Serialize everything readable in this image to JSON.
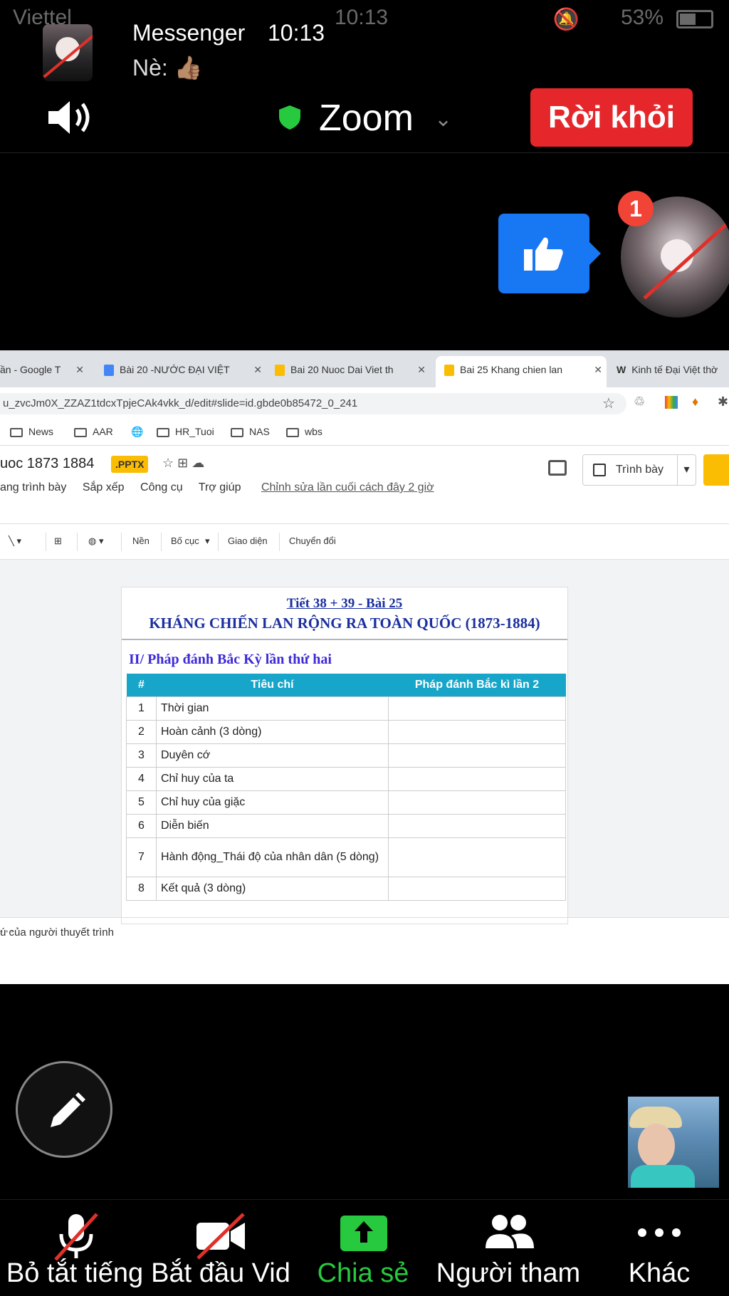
{
  "status_bar": {
    "carrier": "Viettel",
    "time": "10:13",
    "battery": "53%"
  },
  "notification": {
    "app": "Messenger",
    "time": "10:13",
    "message": "Nè: 👍🏽"
  },
  "zoom_header": {
    "title": "Zoom",
    "leave_label": "Rời khỏi"
  },
  "reaction": {
    "badge_count": "1"
  },
  "browser": {
    "tabs": [
      {
        "label": "ần - Google T"
      },
      {
        "label": "Bài 20 -NƯỚC ĐẠI VIỆT"
      },
      {
        "label": "Bai 20 Nuoc Dai Viet th"
      },
      {
        "label": "Bai 25 Khang chien lan"
      },
      {
        "label": "Kinh tế Đại Việt thờ"
      }
    ],
    "url": "u_zvcJm0X_ZZAZ1tdcxTpjeCAk4vkk_d/edit#slide=id.gbde0b85472_0_241",
    "bookmarks": [
      "News",
      "AAR",
      "HR_Tuoi",
      "NAS",
      "wbs"
    ]
  },
  "doc": {
    "title": "uoc 1873  1884",
    "badge": ".PPTX",
    "menus": [
      "ang trình bày",
      "Sắp xếp",
      "Công cụ",
      "Trợ giúp"
    ],
    "last_edit": "Chỉnh sửa lần cuối cách đây 2 giờ",
    "present_label": "Trình bày",
    "toolbar": [
      "Nền",
      "Bố cục",
      "Giao diện",
      "Chuyển đổi"
    ],
    "notes_placeholder": "ú của người thuyết trình"
  },
  "slide": {
    "line1": "Tiết 38 + 39 - Bài 25",
    "line2": "KHÁNG CHIẾN LAN RỘNG RA TOÀN QUỐC (1873-1884)",
    "section": "II/ Pháp đánh Bắc Kỳ lần thứ hai",
    "table": {
      "headers": [
        "#",
        "Tiêu chí",
        "Pháp đánh Bắc kì lần 2"
      ],
      "rows": [
        {
          "n": "1",
          "criterion": "Thời gian"
        },
        {
          "n": "2",
          "criterion": "Hoàn cảnh (3 dòng)"
        },
        {
          "n": "3",
          "criterion": "Duyên cớ"
        },
        {
          "n": "4",
          "criterion": "Chỉ huy của ta"
        },
        {
          "n": "5",
          "criterion": "Chỉ huy của giặc"
        },
        {
          "n": "6",
          "criterion": "Diễn biến"
        },
        {
          "n": "7",
          "criterion": "Hành động_Thái độ của nhân dân (5 dòng)"
        },
        {
          "n": "8",
          "criterion": "Kết quả (3 dòng)"
        }
      ]
    }
  },
  "bottom_bar": {
    "mute": "Bỏ tắt tiếng",
    "video": "Bắt đầu Vid",
    "share": "Chia sẻ",
    "participants": "Người tham",
    "more": "Khác"
  },
  "colors": {
    "leave": "#e5272b",
    "share_green": "#27c93f",
    "like_blue": "#1877f2",
    "table_header": "#17a6c9",
    "slide_title": "#1a2fa0"
  }
}
